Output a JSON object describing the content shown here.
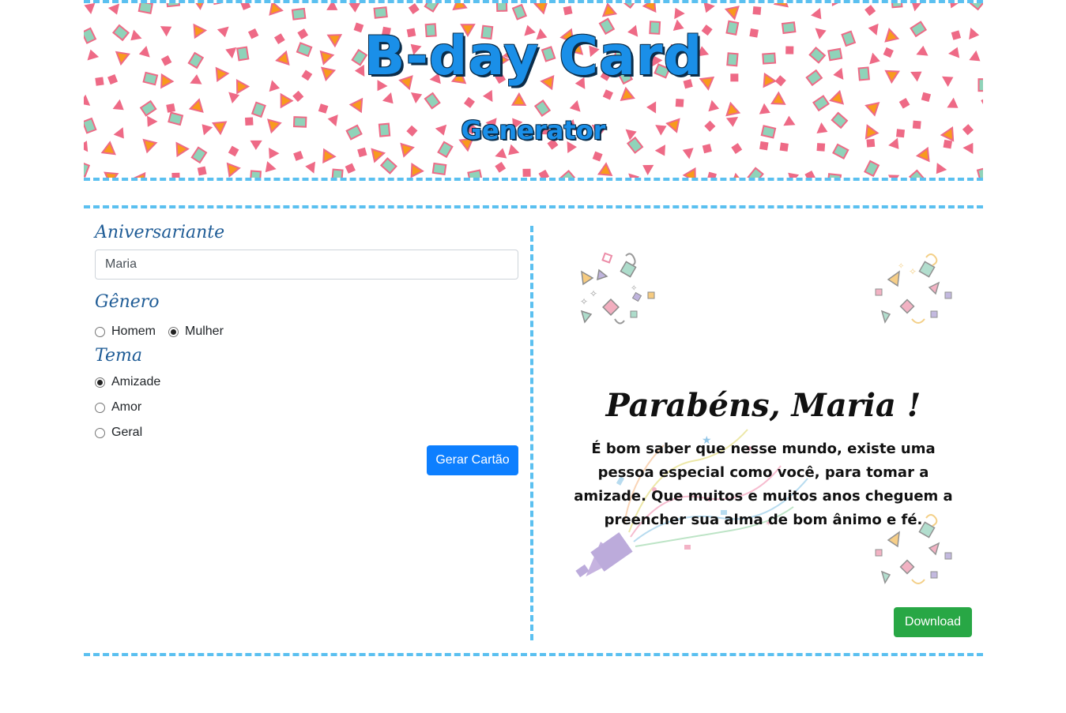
{
  "header": {
    "title": "B-day Card",
    "subtitle": "Generator"
  },
  "form": {
    "name_label": "Aniversariante",
    "name_value": "Maria",
    "gender_label": "Gênero",
    "gender_options": [
      {
        "label": "Homem",
        "checked": false
      },
      {
        "label": "Mulher",
        "checked": true
      }
    ],
    "theme_label": "Tema",
    "theme_options": [
      {
        "label": "Amizade",
        "checked": true
      },
      {
        "label": "Amor",
        "checked": false
      },
      {
        "label": "Geral",
        "checked": false
      }
    ],
    "generate_button": "Gerar Cartão"
  },
  "card": {
    "title": "Parabéns, Maria !",
    "message": "É bom saber que nesse mundo, existe uma pessoa especial como você, para tomar a amizade. Que muitos e muitos anos cheguem a preencher sua alma de bom ânimo e fé.",
    "download_button": "Download"
  },
  "colors": {
    "accent": "#5bc0f0",
    "title_blue": "#1a8fe8",
    "label_blue": "#1f5c96",
    "primary": "#0d7fff",
    "success": "#28a745",
    "confetti_pink": "#ee6a86",
    "confetti_green": "#8fd3b9",
    "confetti_orange": "#f89a1c"
  }
}
